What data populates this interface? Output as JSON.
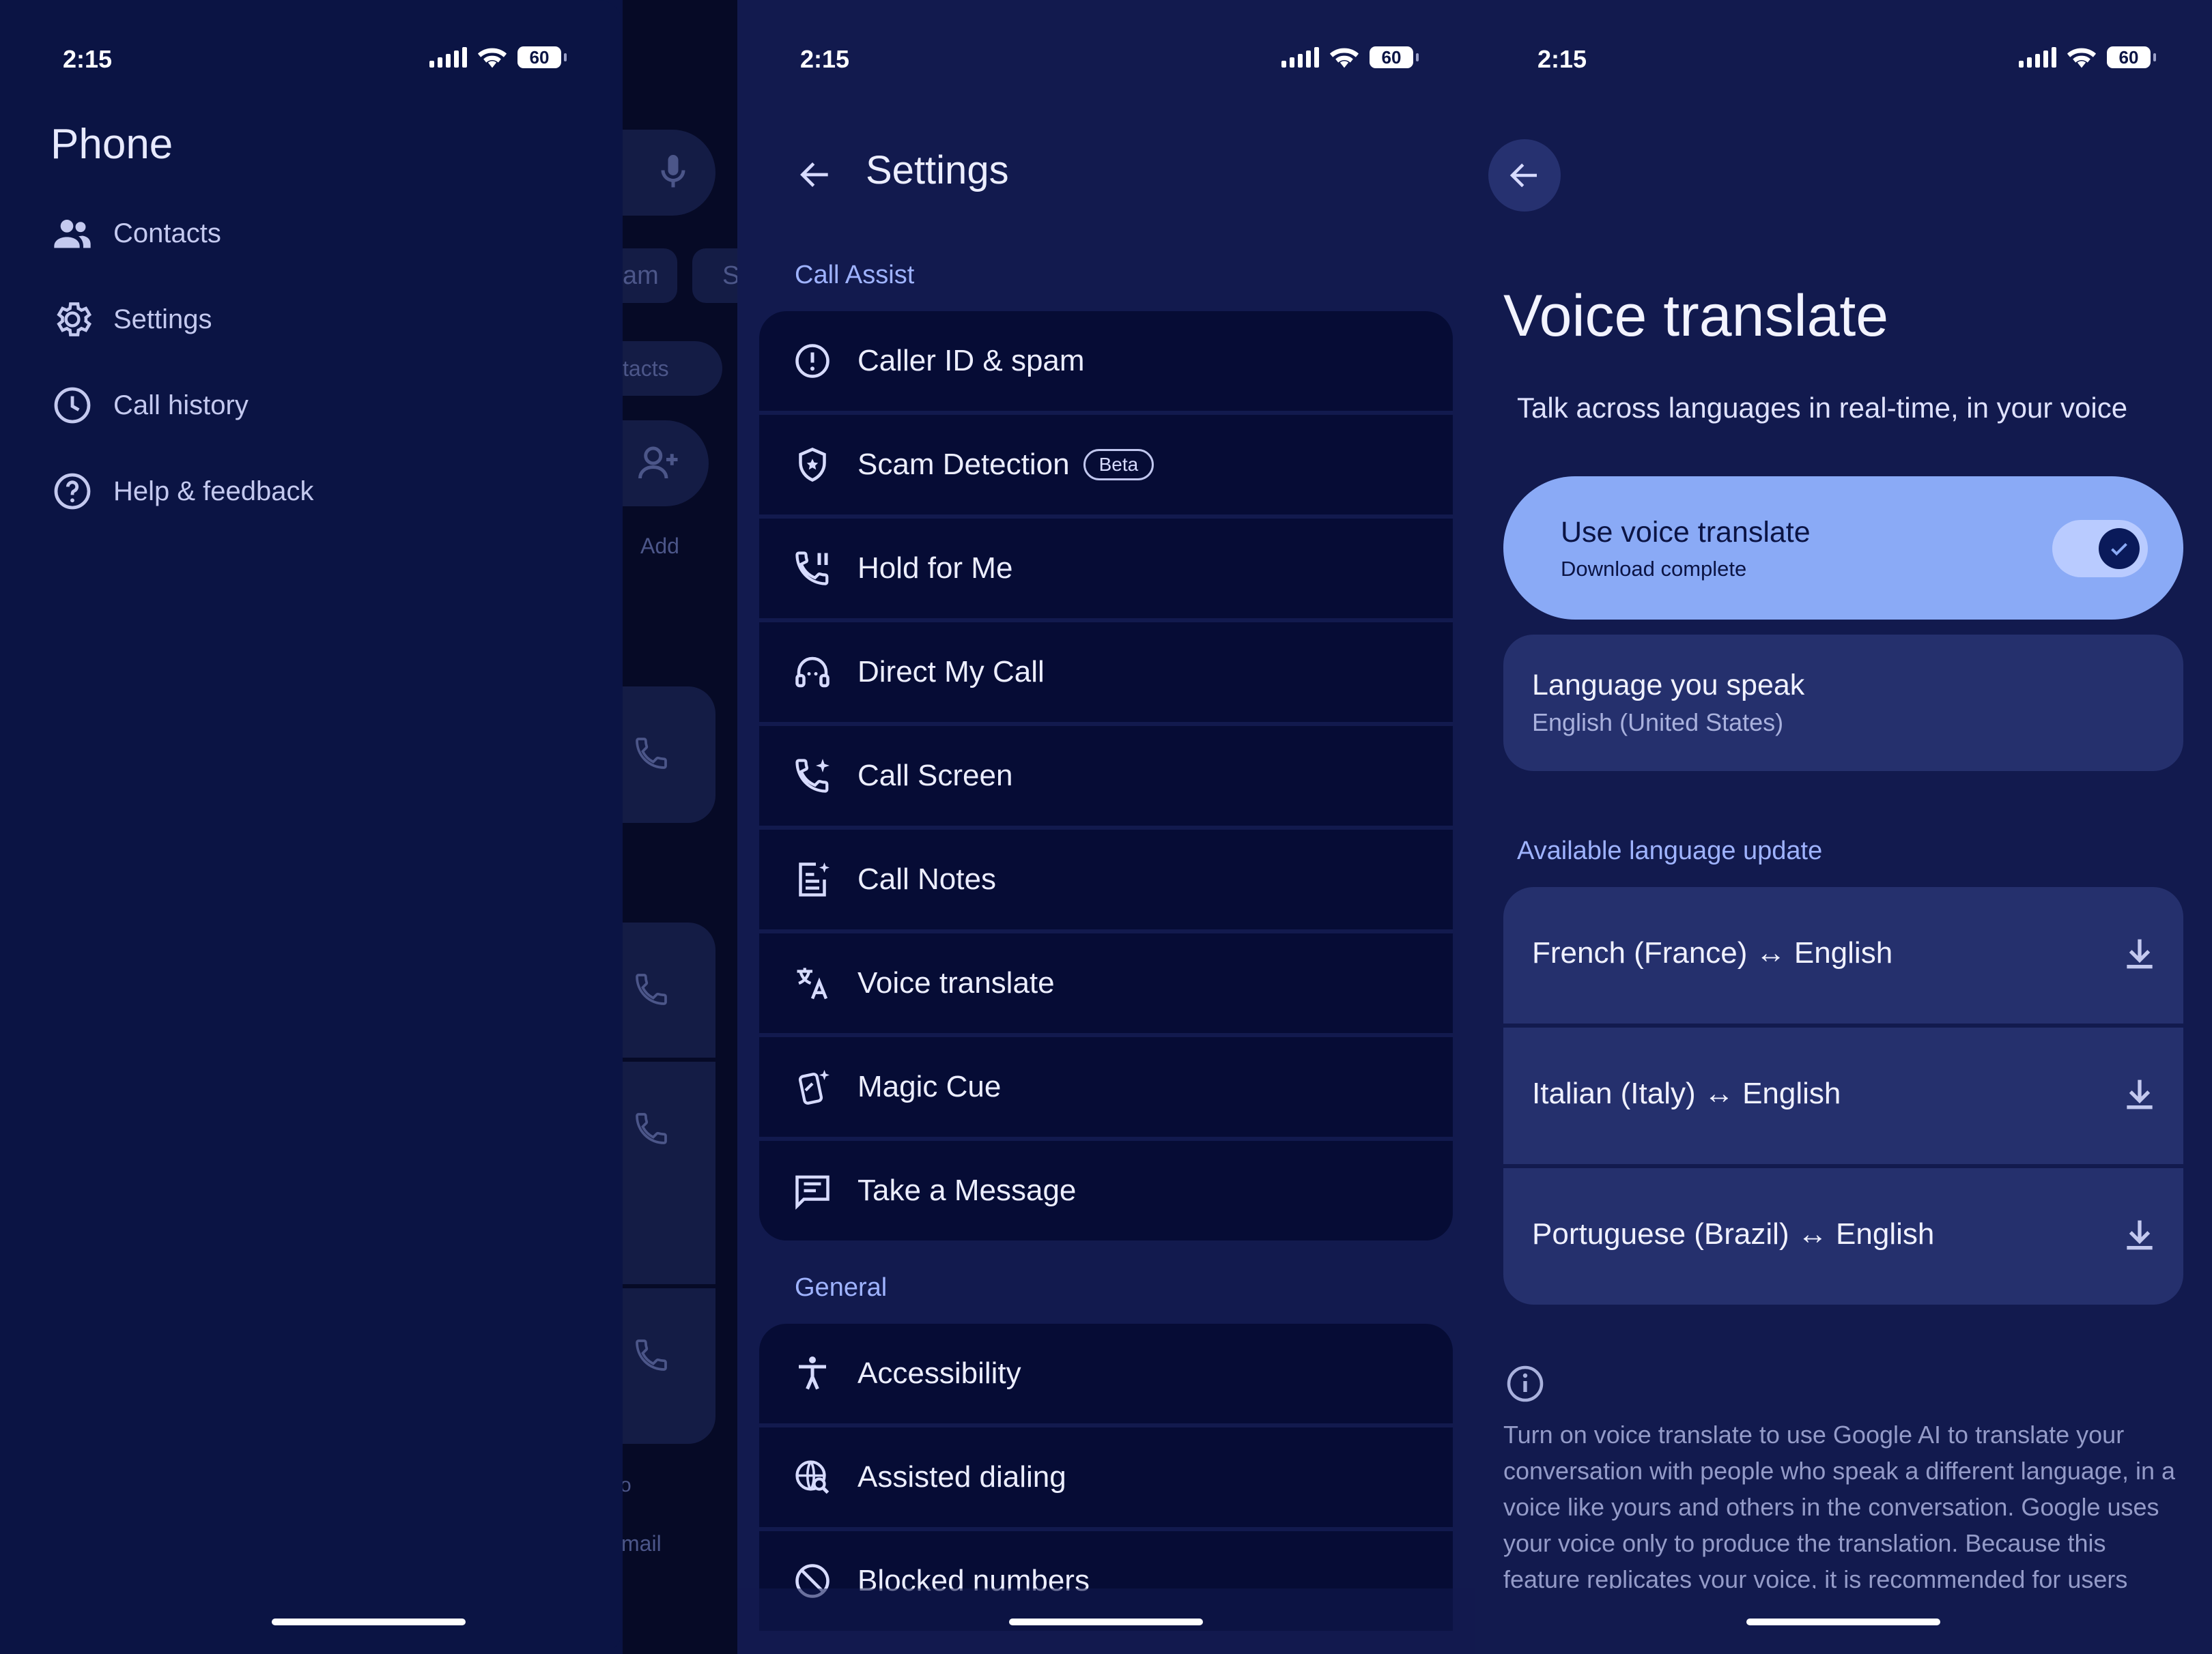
{
  "status_bar": {
    "time": "2:15",
    "battery": "60"
  },
  "phone_drawer": {
    "title": "Phone",
    "items": [
      {
        "label": "Contacts",
        "icon": "contacts-icon"
      },
      {
        "label": "Settings",
        "icon": "gear-icon"
      },
      {
        "label": "Call history",
        "icon": "clock-icon"
      },
      {
        "label": "Help & feedback",
        "icon": "help-icon"
      }
    ],
    "background_fragments": {
      "chip_1": "am",
      "chip_2": "S",
      "chip_3": "tacts",
      "add_label": "Add",
      "bottom_1": "o",
      "bottom_2": "mail"
    }
  },
  "settings": {
    "title": "Settings",
    "section_call_assist": "Call Assist",
    "call_assist_items": [
      {
        "label": "Caller ID & spam",
        "icon": "alert-circle-icon"
      },
      {
        "label": "Scam Detection",
        "icon": "shield-icon",
        "badge": "Beta"
      },
      {
        "label": "Hold for Me",
        "icon": "phone-hold-icon"
      },
      {
        "label": "Direct My Call",
        "icon": "headset-icon"
      },
      {
        "label": "Call Screen",
        "icon": "phone-sparkle-icon"
      },
      {
        "label": "Call Notes",
        "icon": "notes-icon"
      },
      {
        "label": "Voice translate",
        "icon": "translate-icon"
      },
      {
        "label": "Magic Cue",
        "icon": "magic-cue-icon"
      },
      {
        "label": "Take a Message",
        "icon": "message-icon"
      }
    ],
    "section_general": "General",
    "general_items": [
      {
        "label": "Accessibility",
        "icon": "accessibility-icon"
      },
      {
        "label": "Assisted dialing",
        "icon": "globe-search-icon"
      },
      {
        "label": "Blocked numbers",
        "icon": "block-icon"
      }
    ]
  },
  "voice_translate": {
    "title": "Voice translate",
    "subtitle": "Talk across languages in real-time, in your voice",
    "toggle": {
      "label": "Use voice translate",
      "status": "Download complete",
      "enabled": true
    },
    "language": {
      "label": "Language you speak",
      "value": "English (United States)"
    },
    "section_updates": "Available language update",
    "updates": [
      {
        "label": "French (France) ↔ English"
      },
      {
        "label": "Italian (Italy) ↔ English"
      },
      {
        "label": "Portuguese (Brazil) ↔ English"
      }
    ],
    "info_text": "Turn on voice translate to use Google AI to translate your conversation with people who speak a different language, in a voice like yours and others in the conversation. Google uses your voice only to produce the translation. Because this feature replicates your voice, it is recommended for users"
  },
  "colors": {
    "accent": "#8aaaf6",
    "section_label": "#9fb3ff",
    "card": "#25306d",
    "row": "#060c35"
  }
}
